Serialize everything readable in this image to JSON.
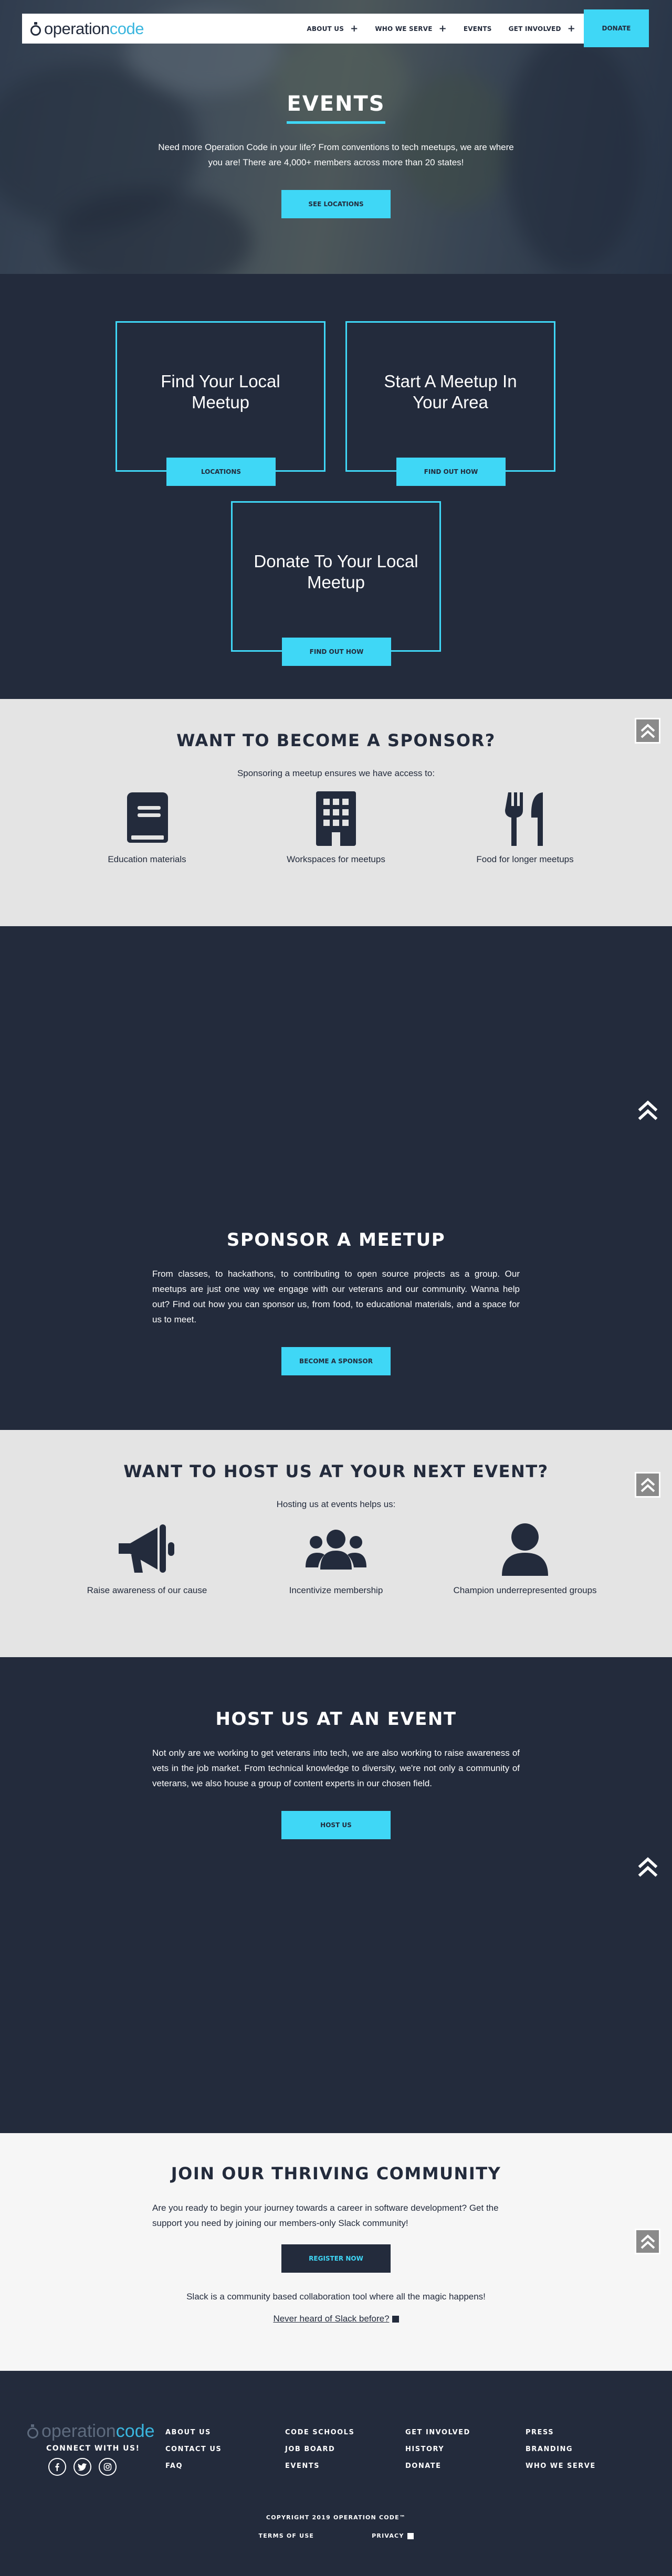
{
  "header": {
    "logo_word1": "operation",
    "logo_word2": "code",
    "nav": [
      {
        "label": "ABOUT US",
        "has_plus": true
      },
      {
        "label": "WHO WE SERVE",
        "has_plus": true
      },
      {
        "label": "EVENTS",
        "has_plus": false
      },
      {
        "label": "GET INVOLVED",
        "has_plus": true
      }
    ],
    "donate_label": "DONATE"
  },
  "hero": {
    "title": "EVENTS",
    "text": "Need more Operation Code in your life? From conventions to tech meetups, we are where you are! There are 4,000+ members across more than 20 states!",
    "button": "SEE LOCATIONS"
  },
  "cards": [
    {
      "title": "Find Your Local Meetup",
      "button": "LOCATIONS"
    },
    {
      "title": "Start A Meetup In Your Area",
      "button": "FIND OUT HOW"
    },
    {
      "title": "Donate To Your Local Meetup",
      "button": "FIND OUT HOW"
    }
  ],
  "sponsor_wants": {
    "title": "WANT TO BECOME A SPONSOR?",
    "subtitle": "Sponsoring a meetup ensures we have access to:",
    "items": [
      {
        "icon": "book-icon",
        "label": "Education materials"
      },
      {
        "icon": "building-icon",
        "label": "Workspaces for meetups"
      },
      {
        "icon": "utensils-icon",
        "label": "Food for longer meetups"
      }
    ]
  },
  "sponsor_meetup": {
    "title": "SPONSOR A MEETUP",
    "text": "From classes, to hackathons, to contributing to open source projects as a group. Our meetups are just one way we engage with our veterans and our community. Wanna help out? Find out how you can sponsor us, from food, to educational materials, and a space for us to meet.",
    "button": "BECOME A SPONSOR"
  },
  "host_wants": {
    "title": "WANT TO HOST US AT YOUR NEXT EVENT?",
    "subtitle": "Hosting us at events helps us:",
    "items": [
      {
        "icon": "megaphone-icon",
        "label": "Raise awareness of our cause"
      },
      {
        "icon": "users-icon",
        "label": "Incentivize membership"
      },
      {
        "icon": "user-icon",
        "label": "Champion underrepresented groups"
      }
    ]
  },
  "host_event": {
    "title": "HOST US AT AN EVENT",
    "text": "Not only are we working to get veterans into tech, we are also working to raise awareness of vets in the job market. From technical knowledge to diversity, we're not only a community of veterans, we also house a group of content experts in our chosen field.",
    "button": "HOST US"
  },
  "community": {
    "title": "JOIN OUR THRIVING COMMUNITY",
    "text": "Are you ready to begin your journey towards a career in software development? Get the support you need by joining our members-only Slack community!",
    "button": "REGISTER NOW",
    "slack_text": "Slack is a community based collaboration tool where all the magic happens!",
    "slack_link": "Never heard of Slack before?"
  },
  "footer": {
    "logo_word1": "operation",
    "logo_word2": "code",
    "connect": "CONNECT WITH US!",
    "socials": [
      "facebook-icon",
      "twitter-icon",
      "instagram-icon"
    ],
    "columns": [
      [
        "ABOUT US",
        "CONTACT US",
        "FAQ"
      ],
      [
        "CODE SCHOOLS",
        "JOB BOARD",
        "EVENTS"
      ],
      [
        "GET INVOLVED",
        "HISTORY",
        "DONATE"
      ],
      [
        "PRESS",
        "BRANDING",
        "WHO WE SERVE"
      ]
    ],
    "copyright": "COPYRIGHT 2019 OPERATION CODE™",
    "terms": "TERMS OF USE",
    "privacy": "PRIVACY"
  },
  "colors": {
    "navy": "#232b3c",
    "cyan": "#3fd7f6",
    "light_gray": "#e4e4e4",
    "off_white": "#f6f6f6"
  }
}
